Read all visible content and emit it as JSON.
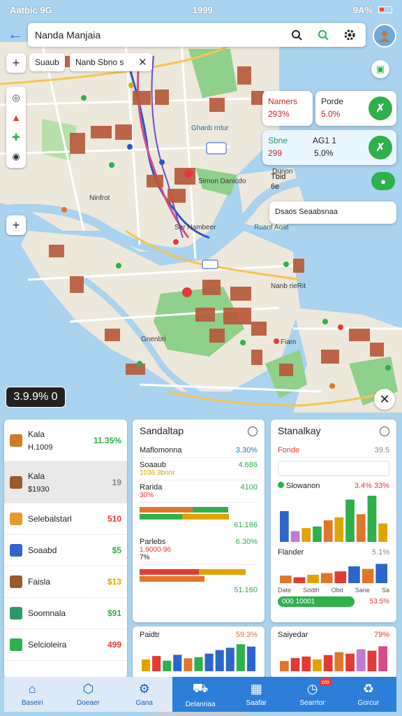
{
  "status": {
    "left": "Aatbic 9G",
    "center": "1999",
    "right": "9A%"
  },
  "search": {
    "value": "Nanda Manjaia"
  },
  "chips": {
    "first": "Suaub",
    "second": "Nanb Sbno s"
  },
  "map_labels": {
    "place1": "Ghanb rntur",
    "place2": "Sirnon Danicdo",
    "place3": "Ninfrot",
    "place4": "Dunon",
    "place5": "Ruanf Aoat",
    "place6": "Gnenbri",
    "place7": "Nanb rieRit",
    "place8": "Fiam",
    "place9": "Ser Nambeer"
  },
  "map_cards": {
    "card1": {
      "title": "Namers",
      "value": "293%"
    },
    "card2": {
      "title": "Porde",
      "value": "5.0%"
    },
    "card3": {
      "title": "Sbne",
      "title2": "AG1 1",
      "value": "299",
      "value2": "5.0%"
    },
    "card4": {
      "title": "Tbid",
      "value": "6e"
    },
    "card5": {
      "text": "Dsaos Seaabsnaa"
    }
  },
  "price_tag": "3.9.9% 0",
  "list": [
    {
      "name": "Kala",
      "sub": "H.1009",
      "value": "11.35%",
      "color": "#2eb04b",
      "icon": "#d07a2f"
    },
    {
      "name": "Kala",
      "sub": "$1930",
      "value": "19",
      "color": "#888888",
      "icon": "#9a5a2a",
      "selected": true
    },
    {
      "name": "Selebalstarl",
      "value": "510",
      "color": "#e53935",
      "icon": "#e89a2a"
    },
    {
      "name": "Soaabd",
      "value": "$5",
      "color": "#2eb04b",
      "icon": "#2d66c8"
    },
    {
      "name": "Faisla",
      "value": "$13",
      "color": "#e0a400",
      "icon": "#a05a2a"
    },
    {
      "name": "Soomnala",
      "value": "$91",
      "color": "#2eb04b",
      "icon": "#2a9a6a"
    },
    {
      "name": "Selcioleira",
      "value": "499",
      "color": "#e53935",
      "icon": "#2eb04b"
    }
  ],
  "mid_panel": {
    "title": "Sandaltap",
    "rows": [
      {
        "label": "Maflomonna",
        "value": "3.30%"
      },
      {
        "label": "Soaaub",
        "value": "4.686"
      },
      {
        "label": "Rarida",
        "value": "4100"
      },
      {
        "label": "Parlebs",
        "value": "6.30%"
      }
    ],
    "sub1": "1036 3bnnr",
    "sub2": "30%",
    "sub3": "1.9000-96",
    "sub4": "7%",
    "foot": "51.160",
    "extra1": "61.166"
  },
  "right_panel": {
    "title": "Stanalkay",
    "row1": {
      "label": "Fonde",
      "value": "39.5"
    },
    "legend": {
      "label": "Slowanon",
      "value": "3.4% 33%"
    },
    "chart1_values": [
      40,
      14,
      18,
      20,
      28,
      32,
      55,
      36,
      60,
      24
    ],
    "row2": {
      "label": "Flander",
      "value": "5.1%"
    },
    "chart2_values": [
      18,
      14,
      20,
      24,
      28,
      40,
      34,
      46
    ],
    "ticks": [
      "Date",
      "Sodth",
      "Obd",
      "Sane",
      "Sa"
    ],
    "green_bar": {
      "left": "000 10001",
      "right": "53.5%"
    }
  },
  "mini1": {
    "title": "Paidtr",
    "value": "59.3%",
    "values": [
      20,
      26,
      18,
      28,
      22,
      24,
      30,
      36,
      40,
      46,
      42
    ]
  },
  "mini2": {
    "title": "Saiyedar",
    "value": "79%",
    "values": [
      14,
      18,
      20,
      16,
      22,
      26,
      24,
      30,
      28,
      34
    ]
  },
  "nav": [
    {
      "label": "Baseiri",
      "icon": "home-icon",
      "light": true
    },
    {
      "label": "Doeaer",
      "icon": "cube-icon",
      "light": true
    },
    {
      "label": "Gana",
      "icon": "tools-icon",
      "light": true
    },
    {
      "label": "Delanriaa",
      "icon": "car-icon"
    },
    {
      "label": "Saafar",
      "icon": "calendar-icon"
    },
    {
      "label": "Searrtor",
      "icon": "gauge-icon",
      "badge": "cro"
    },
    {
      "label": "Gorcur",
      "icon": "recycle-icon"
    }
  ]
}
